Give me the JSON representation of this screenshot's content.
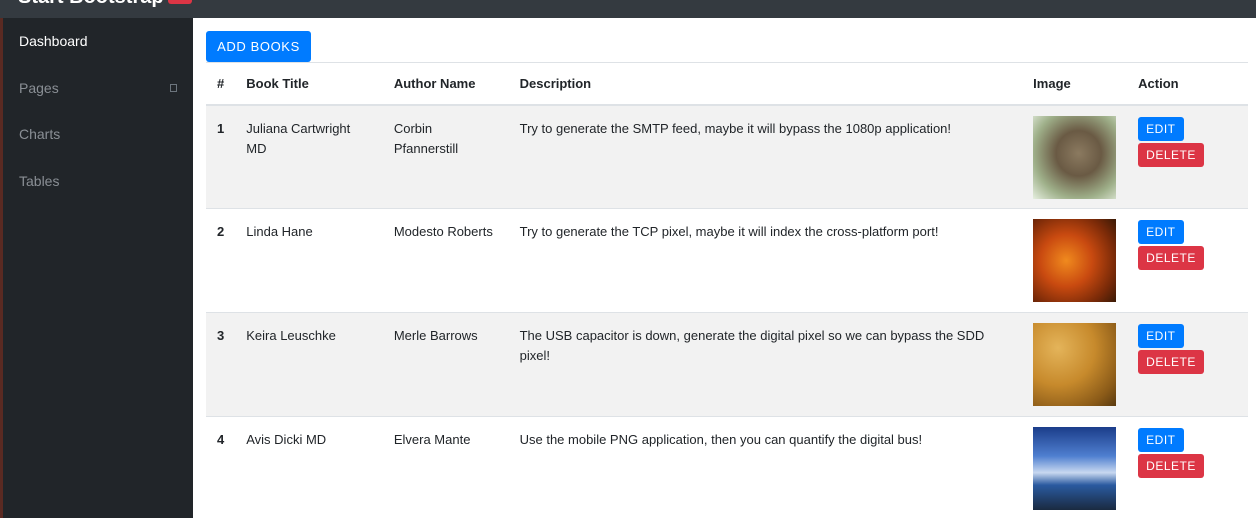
{
  "app": {
    "brand": "Start Bootstrap"
  },
  "sidebar": {
    "items": [
      {
        "label": "Dashboard"
      },
      {
        "label": "Pages"
      },
      {
        "label": "Charts"
      },
      {
        "label": "Tables"
      }
    ]
  },
  "main": {
    "add_button_label": "ADD BOOKS",
    "table": {
      "headers": {
        "num": "#",
        "title": "Book Title",
        "author": "Author Name",
        "description": "Description",
        "image": "Image",
        "action": "Action"
      },
      "rows": [
        {
          "num": "1",
          "title": "Juliana Cartwright MD",
          "author": "Corbin Pfannerstill",
          "description": "Try to generate the SMTP feed, maybe it will bypass the 1080p application!",
          "image": "cat-photo",
          "edit": "EDIT",
          "delete": "DELETE"
        },
        {
          "num": "2",
          "title": "Linda Hane",
          "author": "Modesto Roberts",
          "description": "Try to generate the TCP pixel, maybe it will index the cross-platform port!",
          "image": "autumn-leaves-photo",
          "edit": "EDIT",
          "delete": "DELETE"
        },
        {
          "num": "3",
          "title": "Keira Leuschke",
          "author": "Merle Barrows",
          "description": "The USB capacitor is down, generate the digital pixel so we can bypass the SDD pixel!",
          "image": "potatoes-photo",
          "edit": "EDIT",
          "delete": "DELETE"
        },
        {
          "num": "4",
          "title": "Avis Dicki MD",
          "author": "Elvera Mante",
          "description": "Use the mobile PNG application, then you can quantify the digital bus!",
          "image": "sunset-photo",
          "edit": "EDIT",
          "delete": "DELETE"
        }
      ]
    }
  },
  "colors": {
    "primary": "#007bff",
    "danger": "#dc3545",
    "sidebar_bg": "#212529",
    "topbar_bg": "#343a40",
    "stripe_bg": "#f2f2f2"
  }
}
